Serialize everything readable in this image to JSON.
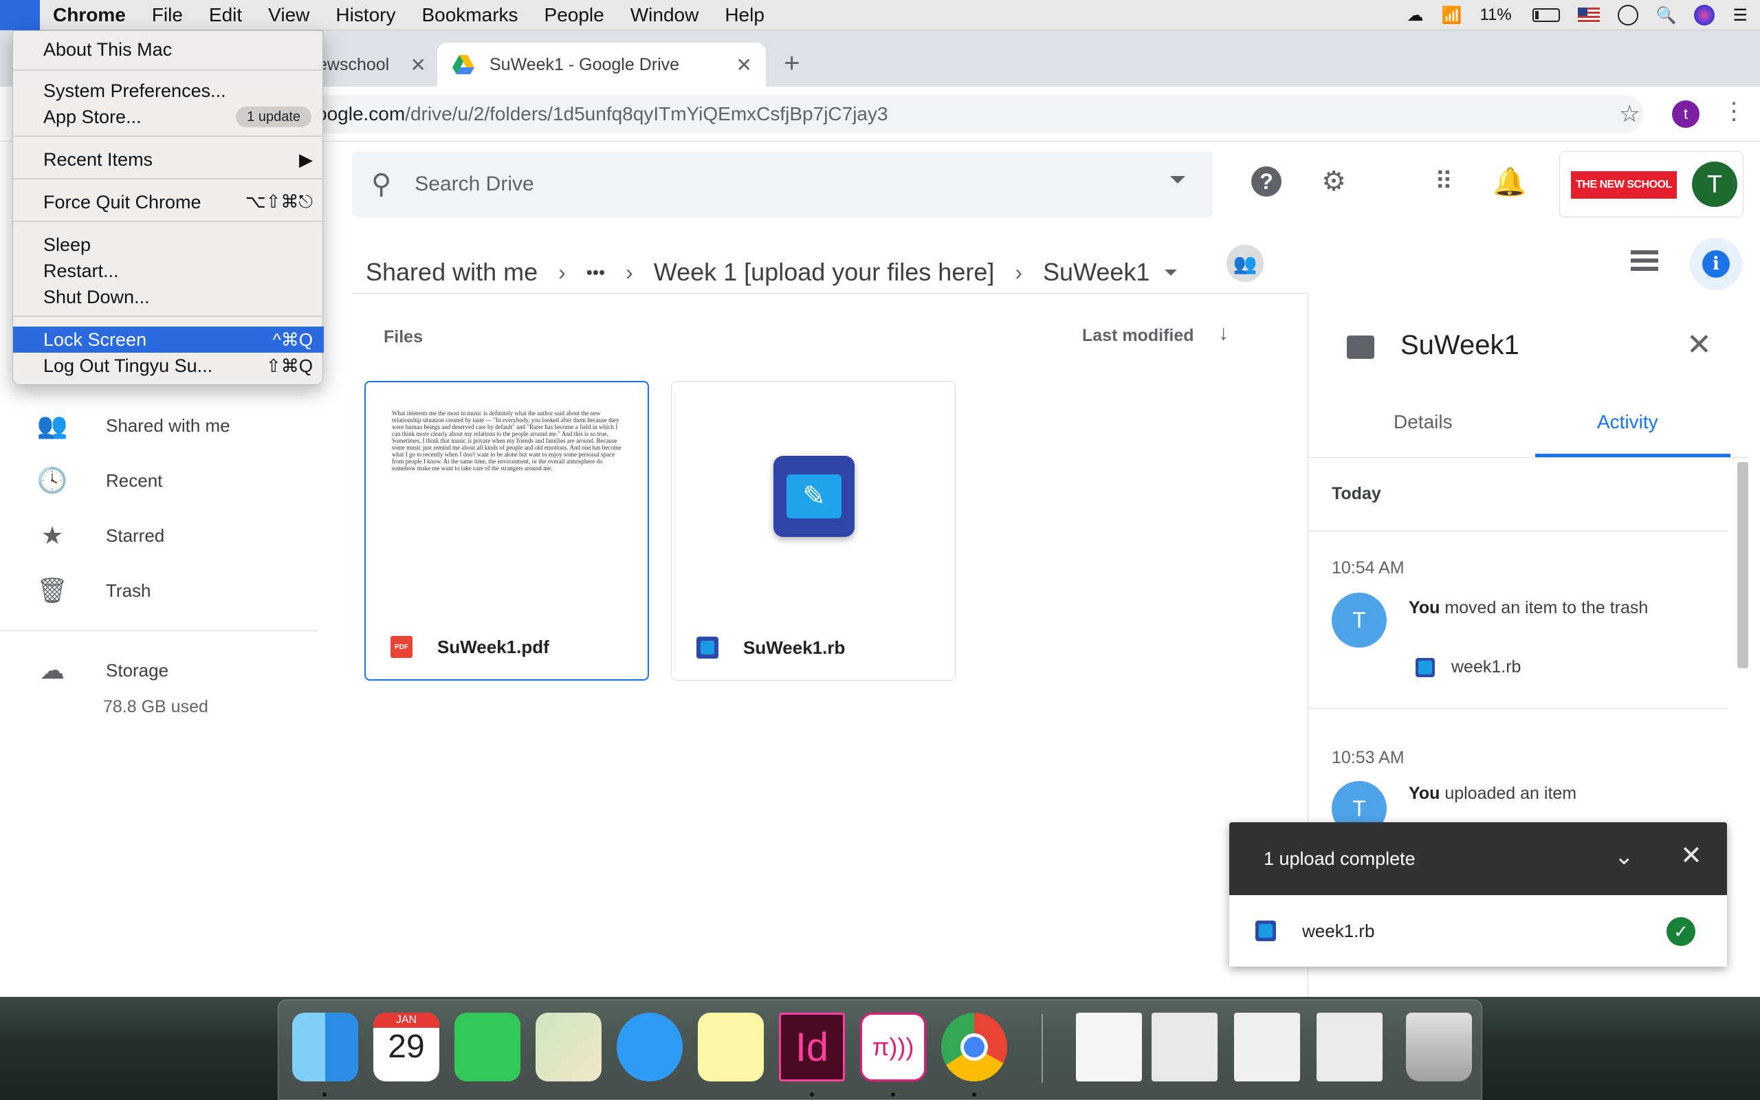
{
  "menubar": {
    "apple_icon": "apple-icon",
    "app": "Chrome",
    "items": [
      "File",
      "Edit",
      "View",
      "History",
      "Bookmarks",
      "People",
      "Window",
      "Help"
    ],
    "battery": "11%"
  },
  "apple_menu": {
    "about": "About This Mac",
    "sysprefs": "System Preferences...",
    "appstore": "App Store...",
    "appstore_badge": "1 update",
    "recent": "Recent Items",
    "force_quit": "Force Quit Chrome",
    "force_quit_sc": "⌥⇧⌘⎋",
    "sleep": "Sleep",
    "restart": "Restart...",
    "shutdown": "Shut Down...",
    "lock": "Lock Screen",
    "lock_sc": "^⌘Q",
    "logout": "Log Out Tingyu Su...",
    "logout_sc": "⇧⌘Q"
  },
  "browser": {
    "tab1_title": "ewschool",
    "tab2_title": "SuWeek1 - Google Drive",
    "url_host": "oogle.com",
    "url_path": "/drive/u/2/folders/1d5unfq8qyITmYiQEmxCsfjBp7jC7jay3",
    "profile_initial": "t"
  },
  "drive": {
    "search_placeholder": "Search Drive",
    "org_logo_text": "THE NEW SCHOOL",
    "avatar_initial": "T",
    "breadcrumb": {
      "root": "Shared with me",
      "ellipsis": "•••",
      "parent": "Week 1 [upload your files here]",
      "current": "SuWeek1"
    },
    "sidebar": {
      "shared": "Shared with me",
      "recent": "Recent",
      "starred": "Starred",
      "trash": "Trash",
      "storage": "Storage",
      "storage_used": "78.8 GB used"
    },
    "files_label": "Files",
    "sort_label": "Last modified",
    "files": [
      {
        "name": "SuWeek1.pdf",
        "type_badge": "PDF"
      },
      {
        "name": "SuWeek1.rb"
      }
    ],
    "pdf_preview_text": "What interests me the most in music is definitely what the author said about the new relationship situation created by taste — \"In everybody, you looked after them because they were human beings and deserved care by default\" and \"Rarer has become a field in which I can think more clearly about my relations to the people around me.\" And this is so true. Sometimes, I think that music is private when my friends and families are around. Because some music just remind me about all kinds of people and old emotions. And one has become what I go to recently when I don't want to be alone but want to enjoy some personal space from people I know. At the same time, the environment, or the overall atmosphere do somehow make me want to take care of the strangers around me."
  },
  "details_panel": {
    "title": "SuWeek1",
    "tab_details": "Details",
    "tab_activity": "Activity",
    "today": "Today",
    "activities": [
      {
        "time": "10:54 AM",
        "avatar": "T",
        "actor": "You",
        "text": " moved an item to the trash",
        "file": "week1.rb"
      },
      {
        "time": "10:53 AM",
        "avatar": "T",
        "actor": "You",
        "text": " uploaded an item"
      }
    ]
  },
  "upload": {
    "status": "1 upload complete",
    "file": "week1.rb"
  },
  "dock": {
    "calendar_month": "JAN",
    "calendar_day": "29",
    "indesign_label": "Id",
    "pi_label": "π)))"
  },
  "colors": {
    "accent": "#1a73e8",
    "menu_highlight": "#2a6ae0",
    "pdf_red": "#ea4335",
    "success": "#188038",
    "newschool_red": "#e51f2d"
  }
}
